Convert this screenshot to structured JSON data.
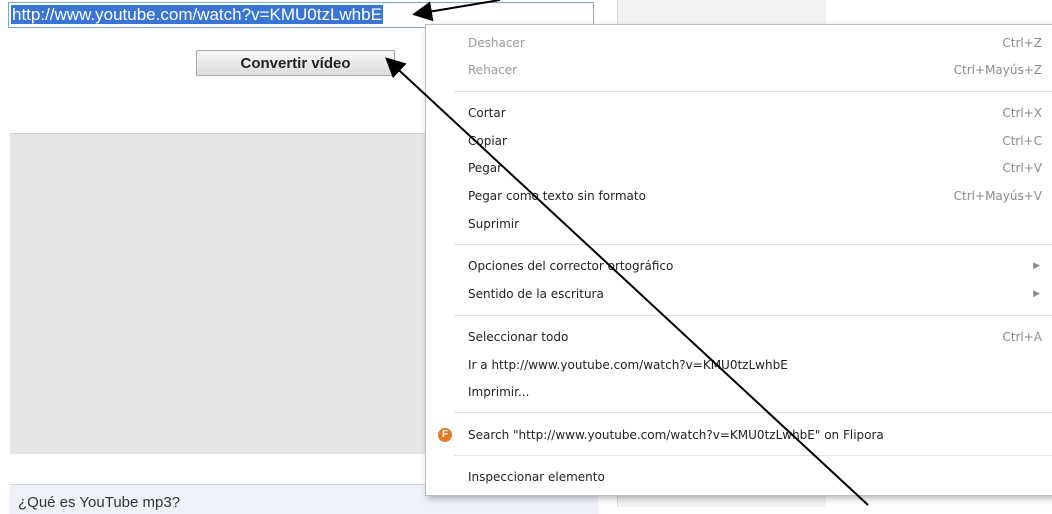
{
  "page": {
    "url_value": "http://www.youtube.com/watch?v=KMU0tzLwhbE",
    "convert_button": "Convertir vídeo",
    "faq_heading": "¿Qué es YouTube mp3?"
  },
  "context_menu": {
    "items": [
      {
        "label": "Deshacer",
        "shortcut": "Ctrl+Z",
        "disabled": true
      },
      {
        "label": "Rehacer",
        "shortcut": "Ctrl+Mayús+Z",
        "disabled": true
      },
      {
        "label": "Cortar",
        "shortcut": "Ctrl+X"
      },
      {
        "label": "Copiar",
        "shortcut": "Ctrl+C"
      },
      {
        "label": "Pegar",
        "shortcut": "Ctrl+V"
      },
      {
        "label": "Pegar como texto sin formato",
        "shortcut": "Ctrl+Mayús+V"
      },
      {
        "label": "Suprimir",
        "shortcut": ""
      },
      {
        "label": "Opciones del corrector ortográfico",
        "submenu": "▶"
      },
      {
        "label": "Sentido de la escritura",
        "submenu": "▶"
      },
      {
        "label": "Seleccionar todo",
        "shortcut": "Ctrl+A"
      },
      {
        "label": "Ir a http://www.youtube.com/watch?v=KMU0tzLwhbE",
        "shortcut": ""
      },
      {
        "label": "Imprimir...",
        "shortcut": ""
      },
      {
        "label": "Search \"http://www.youtube.com/watch?v=KMU0tzLwhbE\" on Flipora",
        "icon": "flipora-icon",
        "icon_glyph": "F"
      },
      {
        "label": "Inspeccionar elemento",
        "shortcut": ""
      }
    ]
  },
  "colors": {
    "selection": "#3875d7",
    "annotation_arrow": "#000000",
    "flipora_icon": "#e07a2a"
  }
}
